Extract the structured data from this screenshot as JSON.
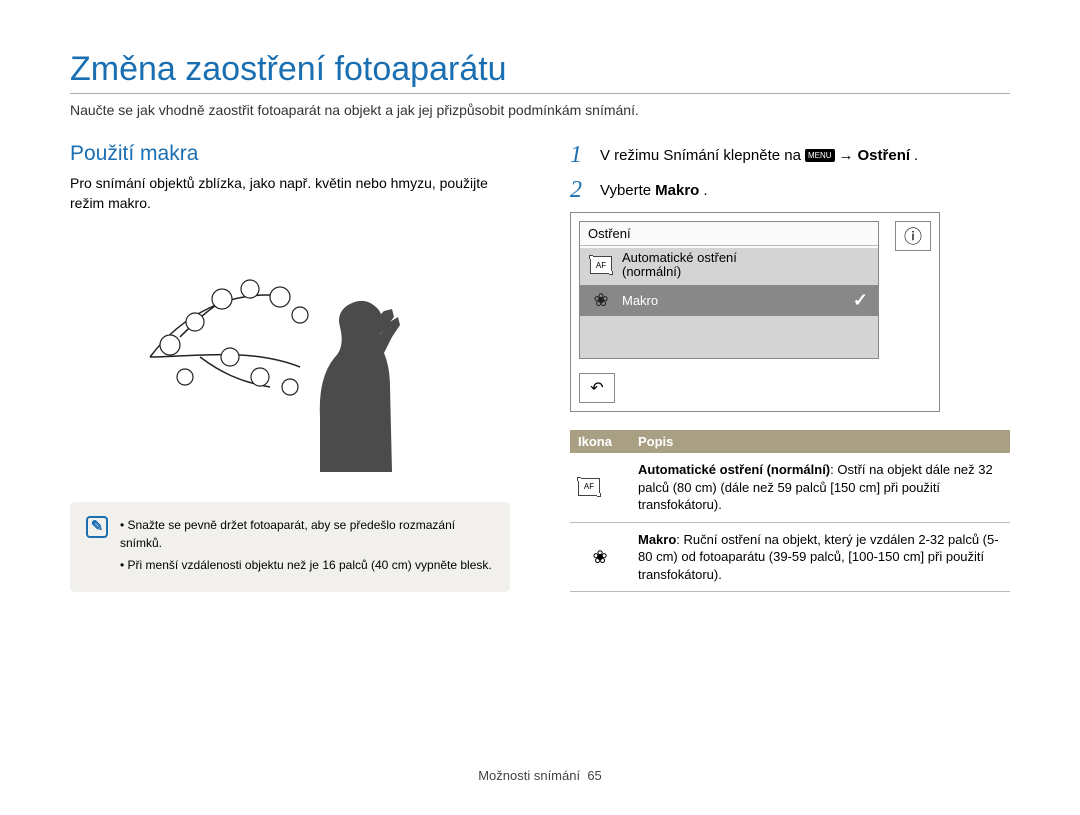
{
  "title": "Změna zaostření fotoaparátu",
  "intro": "Naučte se jak vhodně zaostřit fotoaparát na objekt a jak jej přizpůsobit podmínkám snímání.",
  "left": {
    "heading": "Použití makra",
    "body": "Pro snímání objektů zblízka, jako např. květin nebo hmyzu, použijte režim makro.",
    "tips": [
      "Snažte se pevně držet fotoaparát, aby se předešlo rozmazání snímků.",
      "Při menší vzdálenosti objektu než je 16 palců (40 cm) vypněte blesk."
    ]
  },
  "right": {
    "steps": [
      {
        "num": "1",
        "pre": "V režimu Snímání klepněte na",
        "chip": "MENU",
        "arrow": "→",
        "bold": "Ostření",
        "suffix": "."
      },
      {
        "num": "2",
        "pre": "Vyberte",
        "bold": "Makro",
        "suffix": "."
      }
    ],
    "screen": {
      "title": "Ostření",
      "option_af_line1": "Automatické ostření",
      "option_af_line2": "(normální)",
      "option_makro": "Makro",
      "info_glyph": "ⓘ",
      "back_glyph": "↶",
      "check_glyph": "✓"
    },
    "table": {
      "h_icon": "Ikona",
      "h_desc": "Popis",
      "rows": [
        {
          "icon": "af",
          "bold": "Automatické ostření (normální)",
          "text": ": Ostří na objekt dále než 32 palců (80 cm) (dále než 59 palců [150 cm] při použití transfokátoru)."
        },
        {
          "icon": "flower",
          "bold": "Makro",
          "text": ": Ruční ostření na objekt, který je vzdálen 2-32 palců (5-80 cm) od fotoaparátu (39-59 palců, [100-150 cm] při použití transfokátoru)."
        }
      ]
    }
  },
  "footer": {
    "section": "Možnosti snímání",
    "page": "65"
  }
}
